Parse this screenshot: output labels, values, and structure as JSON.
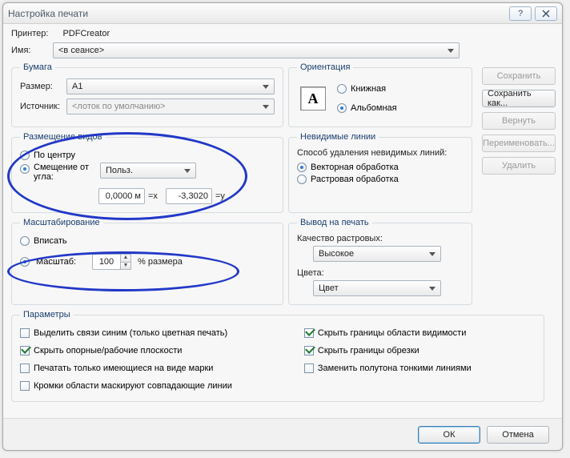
{
  "title": "Настройка печати",
  "printer": {
    "label": "Принтер:",
    "value": "PDFCreator"
  },
  "name": {
    "label": "Имя:",
    "value": "<в сеансе>"
  },
  "side_buttons": {
    "save": "Сохранить",
    "save_as": "Сохранить как...",
    "revert": "Вернуть",
    "rename": "Переименовать...",
    "delete": "Удалить"
  },
  "paper": {
    "legend": "Бумага",
    "size_label": "Размер:",
    "size_value": "A1",
    "source_label": "Источник:",
    "source_value": "<лоток по умолчанию>"
  },
  "orientation": {
    "legend": "Ориентация",
    "portrait": "Книжная",
    "landscape": "Альбомная",
    "selected": "landscape",
    "letter": "A"
  },
  "placement": {
    "legend": "Размещение видов",
    "center": "По центру",
    "offset": "Смещение от угла:",
    "offset_type": "Польз.",
    "x_value": "0,0000 м",
    "x_label": "=x",
    "y_value": "-3,3020",
    "y_label": "=y",
    "selected": "offset"
  },
  "hidden": {
    "legend": "Невидимые линии",
    "method_label": "Способ удаления невидимых линий:",
    "vector": "Векторная обработка",
    "raster": "Растровая обработка",
    "selected": "vector"
  },
  "zoom": {
    "legend": "Масштабирование",
    "fit": "Вписать",
    "scale": "Масштаб:",
    "value": "100",
    "suffix": "% размера",
    "selected": "scale"
  },
  "appearance": {
    "legend": "Вывод на печать",
    "raster_q_label": "Качество растровых:",
    "raster_q_value": "Высокое",
    "colors_label": "Цвета:",
    "colors_value": "Цвет"
  },
  "options": {
    "legend": "Параметры",
    "l1": "Выделить связи синим (только цветная печать)",
    "l2": "Скрыть опорные/рабочие плоскости",
    "l3": "Печатать только имеющиеся на виде марки",
    "l4": "Кромки области маскируют совпадающие линии",
    "r1": "Скрыть границы области видимости",
    "r2": "Скрыть границы обрезки",
    "r3": "Заменить полутона тонкими линиями",
    "checked": {
      "l2": true,
      "r1": true,
      "r2": true
    }
  },
  "footer": {
    "ok": "ОК",
    "cancel": "Отмена"
  }
}
